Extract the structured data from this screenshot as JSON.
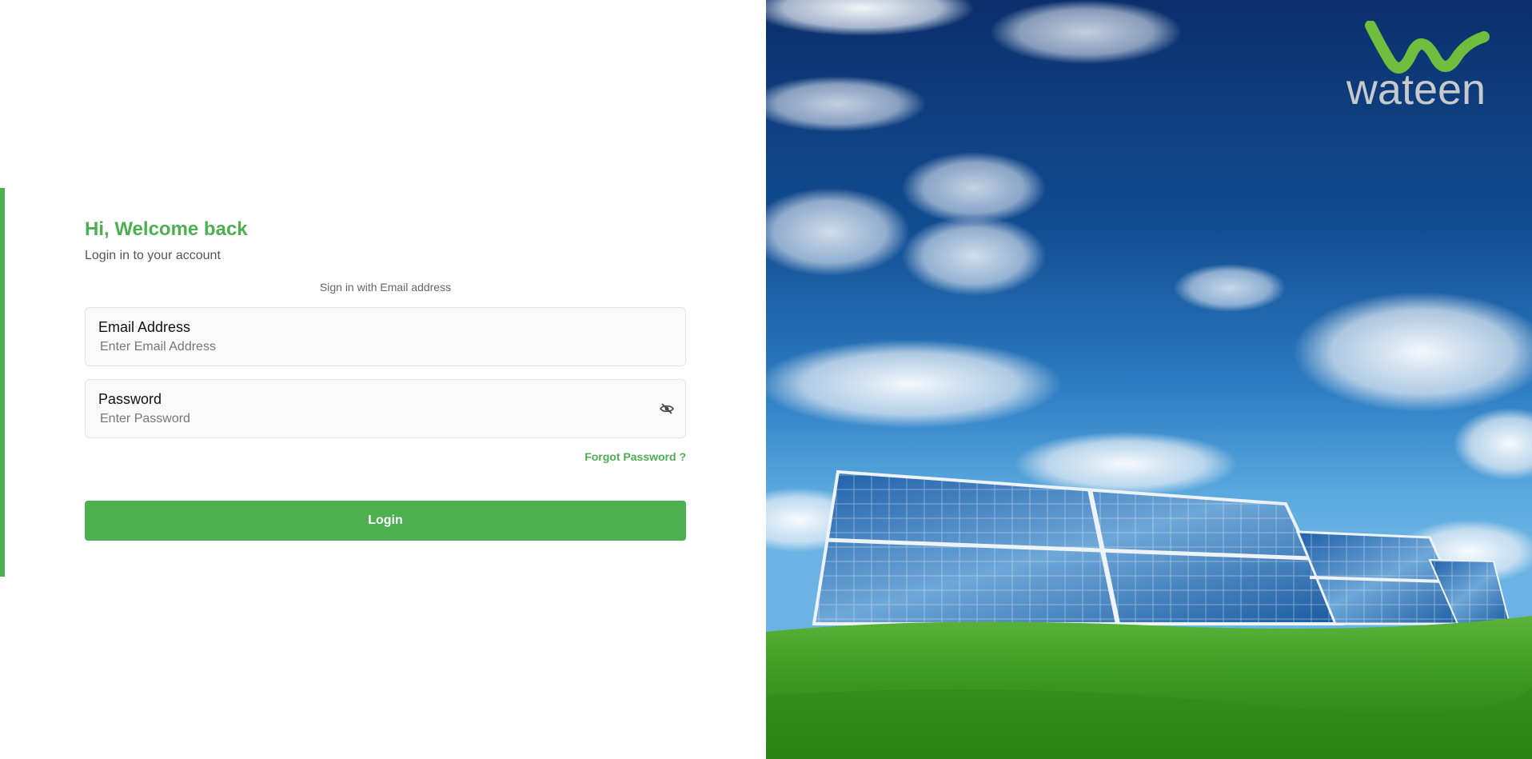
{
  "login": {
    "title": "Hi, Welcome back",
    "subtitle": "Login in to your account",
    "signin_with": "Sign in with Email address",
    "email": {
      "label": "Email Address",
      "placeholder": "Enter Email Address"
    },
    "password": {
      "label": "Password",
      "placeholder": "Enter Password",
      "toggle_icon": "eye-off-icon"
    },
    "forgot_password": "Forgot Password ?",
    "login_button": "Login"
  },
  "brand": {
    "logo_text": "wateen",
    "accent_color": "#4caf50"
  },
  "hero": {
    "description_icon": "solar-panel-landscape-image"
  }
}
